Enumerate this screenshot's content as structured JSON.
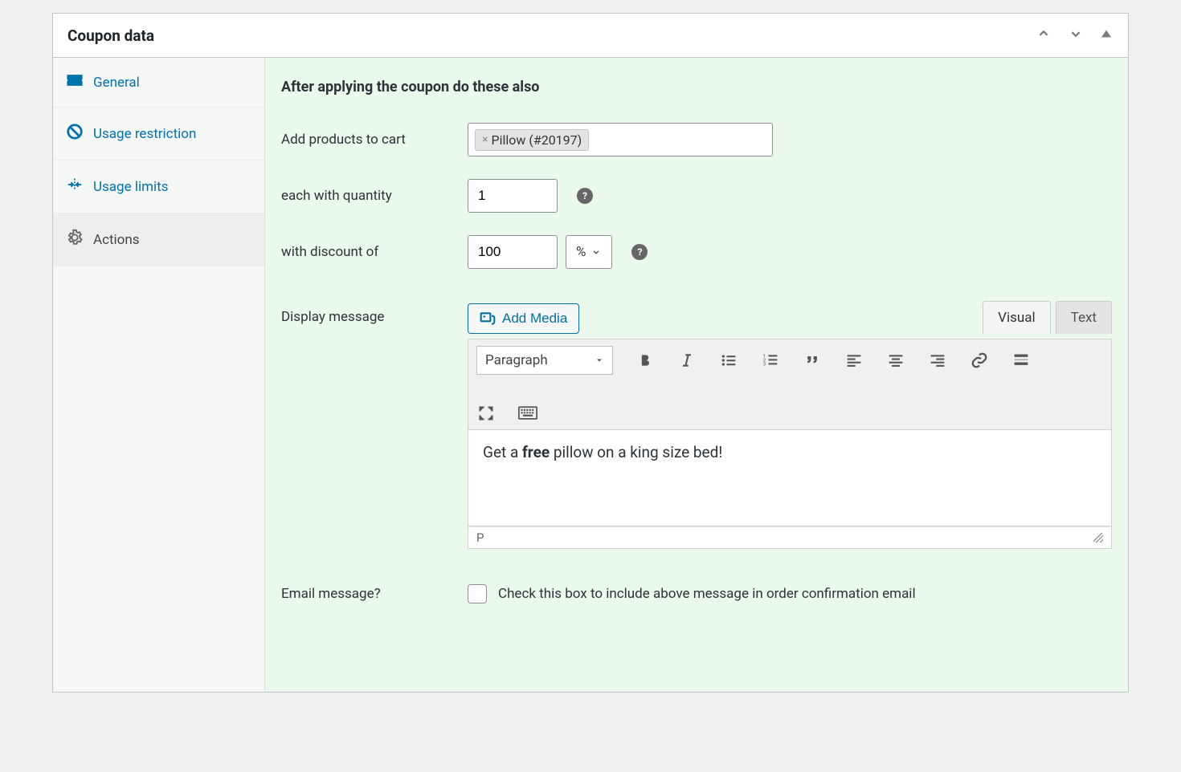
{
  "panel": {
    "title": "Coupon data"
  },
  "sidebar": {
    "items": [
      {
        "label": "General"
      },
      {
        "label": "Usage restriction"
      },
      {
        "label": "Usage limits"
      },
      {
        "label": "Actions"
      }
    ]
  },
  "actions": {
    "section_title": "After applying the coupon do these also",
    "add_products_label": "Add products to cart",
    "product_chip": "Pillow (#20197)",
    "qty_label": "each with quantity",
    "qty_value": "1",
    "discount_label": "with discount of",
    "discount_value": "100",
    "discount_unit": "%",
    "display_message_label": "Display message",
    "add_media_label": "Add Media",
    "tab_visual": "Visual",
    "tab_text": "Text",
    "format_dropdown": "Paragraph",
    "editor_text_before": "Get a ",
    "editor_text_bold": "free",
    "editor_text_after": " pillow on a king size bed!",
    "editor_status": "P",
    "email_label": "Email message?",
    "email_checkbox_label": "Check this box to include above message in order confirmation email"
  }
}
